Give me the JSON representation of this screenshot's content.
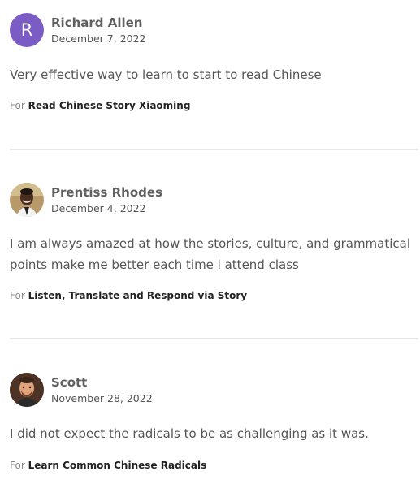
{
  "reviews": [
    {
      "avatar_letter": "R",
      "name": "Richard Allen",
      "date": "December 7, 2022",
      "text": "Very effective way to learn to start to read Chinese",
      "for_label": "For",
      "course": "Read Chinese Story Xiaoming"
    },
    {
      "name": "Prentiss Rhodes",
      "date": "December 4, 2022",
      "text": "I am always amazed at how the stories, culture, and grammatical points make me better each time i attend class",
      "for_label": "For",
      "course": "Listen, Translate and Respond via Story"
    },
    {
      "name": "Scott",
      "date": "November 28, 2022",
      "text": "I did not expect the radicals to be as challenging as it was.",
      "for_label": "For",
      "course": "Learn Common Chinese Radicals"
    }
  ],
  "colors": {
    "avatar_letter_bg": "#7b5bc4",
    "divider": "#e6e6e6"
  }
}
